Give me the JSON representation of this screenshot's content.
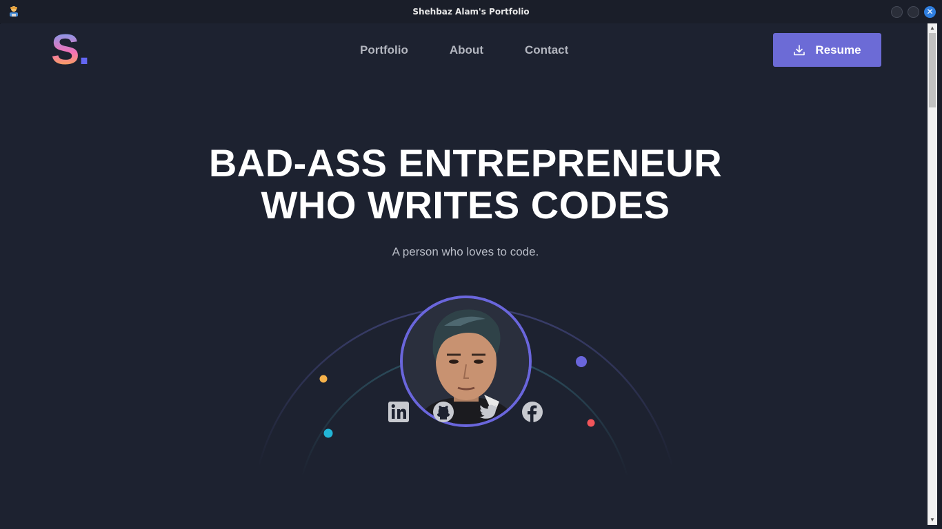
{
  "window": {
    "title": "Shehbaz Alam's Portfolio",
    "close_glyph": "✕"
  },
  "header": {
    "logo_letter": "S",
    "logo_dot": ".",
    "nav": [
      "Portfolio",
      "About",
      "Contact"
    ],
    "resume_label": "Resume"
  },
  "hero": {
    "title_line1": "BAD-ASS ENTREPRENEUR",
    "title_line2": "WHO WRITES CODES",
    "subtitle": "A person who loves to code."
  },
  "social": {
    "links": [
      "linkedin-icon",
      "github-icon",
      "twitter-icon",
      "facebook-icon"
    ]
  },
  "colors": {
    "background": "#1d2230",
    "accent": "#6c6bd6",
    "orbit_dot_orange": "#f6b24a",
    "orbit_dot_cyan": "#22b5d6",
    "orbit_dot_indigo": "#6a66dc",
    "orbit_dot_red": "#f2555a"
  }
}
